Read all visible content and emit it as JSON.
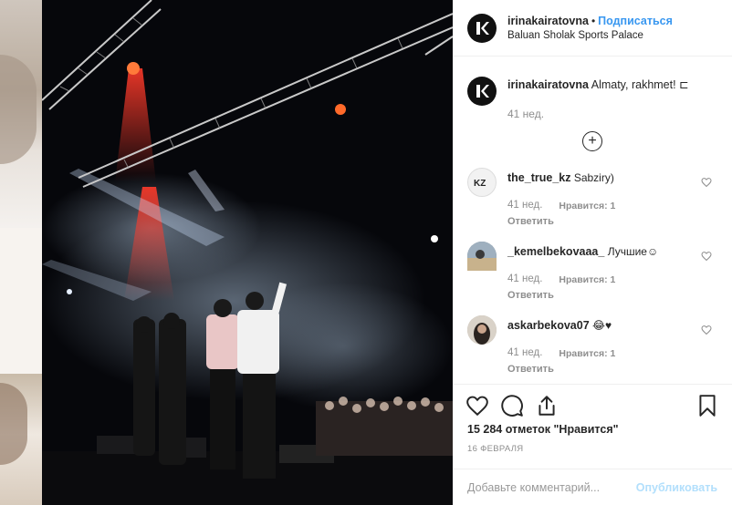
{
  "post": {
    "username": "irinakairatovna",
    "dot": "•",
    "follow_label": "Подписаться",
    "location": "Baluan Sholak Sports Palace",
    "caption_text": "Almaty, rakhmet! ⊏",
    "caption_time": "41 нед.",
    "load_more_icon": "plus-circle-icon"
  },
  "comments": [
    {
      "username": "the_true_kz",
      "text": "Sabziry)",
      "time": "41 нед.",
      "likes": "Нравится: 1",
      "reply": "Ответить"
    },
    {
      "username": "_kemelbekovaaa_",
      "text": "Лучшие☺",
      "time": "41 нед.",
      "likes": "Нравится: 1",
      "reply": "Ответить"
    },
    {
      "username": "askarbekova07",
      "text": "😂♥",
      "time": "41 нед.",
      "likes": "Нравится: 1",
      "reply": "Ответить"
    }
  ],
  "actions": {
    "like_icon": "heart-icon",
    "comment_icon": "comment-icon",
    "share_icon": "share-icon",
    "save_icon": "bookmark-icon"
  },
  "likes_text": "15 284 отметок \"Нравится\"",
  "date": "16 ФЕВРАЛЯ",
  "add_comment": {
    "placeholder": "Добавьте комментарий...",
    "publish_label": "Опубликовать"
  },
  "colors": {
    "link_blue": "#3897f0",
    "publish_disabled": "#b2dffc",
    "muted": "#8e8e8e"
  }
}
